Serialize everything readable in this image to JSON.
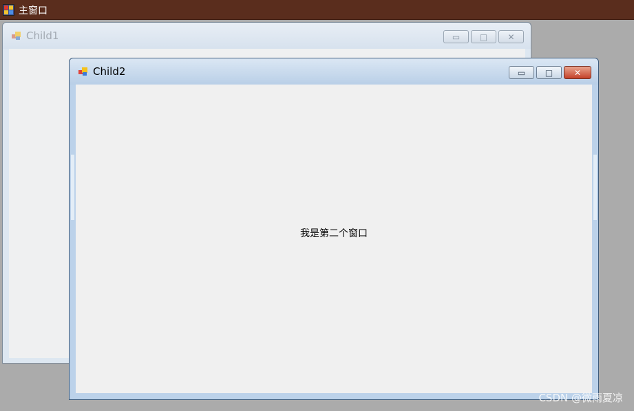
{
  "main_window": {
    "title": "主窗口",
    "icon": "form-app-icon"
  },
  "child1": {
    "title": "Child1",
    "icon": "form-app-icon",
    "buttons": {
      "minimize": "▭",
      "maximize": "□",
      "close": "✕"
    }
  },
  "child2": {
    "title": "Child2",
    "icon": "form-app-icon",
    "buttons": {
      "minimize": "▭",
      "maximize": "□",
      "close": "✕"
    },
    "label": "我是第二个窗口"
  },
  "watermark": "CSDN @微雨夏凉",
  "colors": {
    "main_titlebar": "#5a2d1d",
    "desktop": "#ababab",
    "active_frame": "#bcd2ea",
    "close_button": "#c5422a"
  }
}
